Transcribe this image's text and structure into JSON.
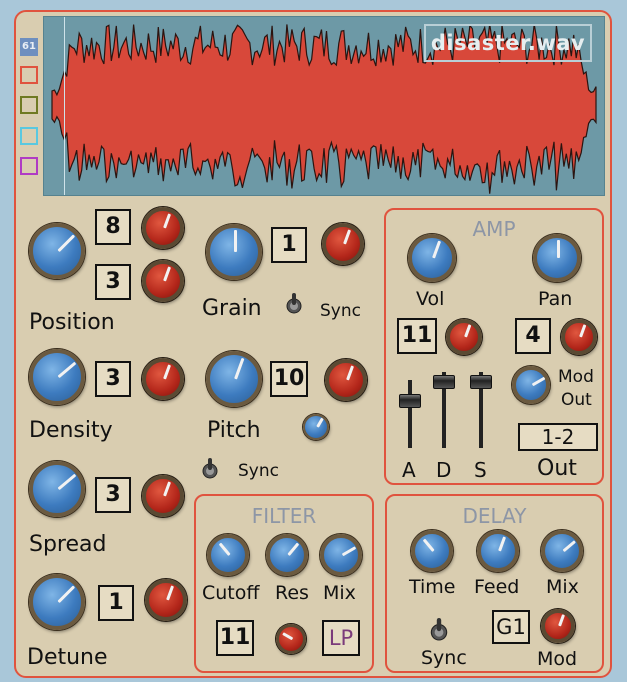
{
  "waveform": {
    "filename": "disaster.wav"
  },
  "slots": [
    {
      "label": "61",
      "color": "#6e8fbf"
    },
    {
      "label": "",
      "color": "#e0533e"
    },
    {
      "label": "",
      "color": "#6f7a22"
    },
    {
      "label": "",
      "color": "#59c8e0"
    },
    {
      "label": "",
      "color": "#b03bc4"
    }
  ],
  "position": {
    "label": "Position",
    "box_top": "8",
    "box_bottom": "3"
  },
  "density": {
    "label": "Density",
    "box": "3"
  },
  "spread": {
    "label": "Spread",
    "box": "3"
  },
  "detune": {
    "label": "Detune",
    "box": "1"
  },
  "grain": {
    "label": "Grain",
    "box": "1",
    "sync_label": "Sync"
  },
  "pitch": {
    "label": "Pitch",
    "box": "10",
    "sync_label": "Sync"
  },
  "amp": {
    "title": "AMP",
    "vol_label": "Vol",
    "pan_label": "Pan",
    "vol_box": "11",
    "pan_box": "4",
    "mod_out_label_1": "Mod",
    "mod_out_label_2": "Out",
    "out_value": "1-2",
    "out_label": "Out",
    "a_label": "A",
    "d_label": "D",
    "s_label": "S"
  },
  "filter": {
    "title": "FILTER",
    "cutoff_label": "Cutoff",
    "res_label": "Res",
    "mix_label": "Mix",
    "box": "11",
    "mode": "LP"
  },
  "delay": {
    "title": "DELAY",
    "time_label": "Time",
    "feed_label": "Feed",
    "mix_label": "Mix",
    "sync_label": "Sync",
    "mod_label": "Mod",
    "mod_box": "G1"
  },
  "colors": {
    "panel": "#d9cdb0",
    "accent_red": "#e0533e",
    "wave_bg": "#6d99a6",
    "wave_fill": "#d8483a"
  }
}
